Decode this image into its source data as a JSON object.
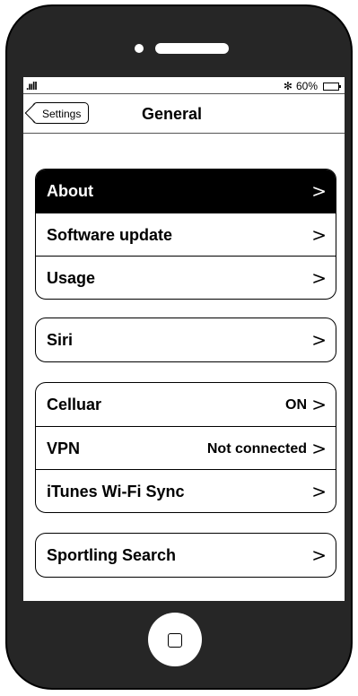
{
  "status": {
    "signal": ".ııll",
    "bluetooth": "✻",
    "battery": "60%"
  },
  "nav": {
    "back_label": "Settings",
    "title": "General"
  },
  "groups": [
    {
      "rows": [
        {
          "label": "About",
          "value": "",
          "selected": true
        },
        {
          "label": "Software update",
          "value": ""
        },
        {
          "label": "Usage",
          "value": ""
        }
      ]
    },
    {
      "rows": [
        {
          "label": "Siri",
          "value": ""
        }
      ]
    },
    {
      "rows": [
        {
          "label": "Celluar",
          "value": "ON"
        },
        {
          "label": "VPN",
          "value": "Not connected"
        },
        {
          "label": "iTunes Wi-Fi Sync",
          "value": ""
        }
      ]
    },
    {
      "rows": [
        {
          "label": "Sportling Search",
          "value": ""
        }
      ]
    }
  ],
  "chevron": ">"
}
